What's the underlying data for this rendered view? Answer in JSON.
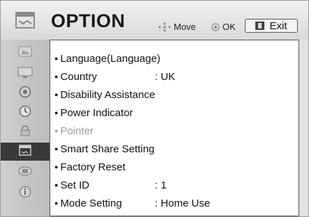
{
  "header": {
    "title": "OPTION",
    "move_label": "Move",
    "ok_label": "OK",
    "exit_label": "Exit"
  },
  "sidebar": {
    "items": [
      {
        "icon": "picture-icon",
        "active": false
      },
      {
        "icon": "tv-icon",
        "active": false
      },
      {
        "icon": "speaker-icon",
        "active": false
      },
      {
        "icon": "clock-icon",
        "active": false
      },
      {
        "icon": "lock-icon",
        "active": false
      },
      {
        "icon": "option-icon",
        "active": true
      },
      {
        "icon": "network-icon",
        "active": false
      },
      {
        "icon": "support-icon",
        "active": false
      }
    ]
  },
  "menu": {
    "items": [
      {
        "label": "Language(Language)",
        "value": "",
        "disabled": false
      },
      {
        "label": "Country",
        "value": ": UK",
        "disabled": false
      },
      {
        "label": "Disability Assistance",
        "value": "",
        "disabled": false
      },
      {
        "label": "Power Indicator",
        "value": "",
        "disabled": false
      },
      {
        "label": "Pointer",
        "value": "",
        "disabled": true
      },
      {
        "label": "Smart Share Setting",
        "value": "",
        "disabled": false
      },
      {
        "label": "Factory Reset",
        "value": "",
        "disabled": false
      },
      {
        "label": "Set ID",
        "value": ": 1",
        "disabled": false
      },
      {
        "label": "Mode Setting",
        "value": ": Home Use",
        "disabled": false
      }
    ]
  },
  "colors": {
    "active_sidebar": "#3a3a3a",
    "disabled_text": "#9c9c9c"
  }
}
